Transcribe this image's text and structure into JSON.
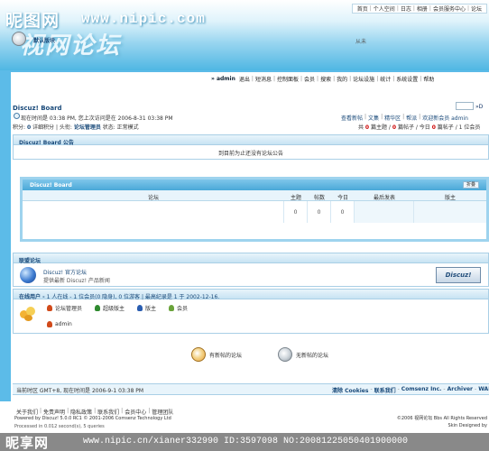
{
  "watermark": {
    "site_name": "昵图网",
    "site_url": "www.nipic.com",
    "bottom_logo": "昵享网",
    "bottom_text": "www.nipic.cn/xianer332990 ID:3597098 NO:20081225050401900000"
  },
  "header": {
    "brand_art": "视网论坛"
  },
  "topnav": [
    "首页",
    "个人空间",
    "日志",
    "相册",
    "会员服务中心",
    "论坛"
  ],
  "userbar": {
    "user": "» admin",
    "links": [
      "退出",
      "短消息",
      "控制面板",
      "会员",
      "搜索",
      "我的",
      "论坛设施",
      "统计",
      "系统设置",
      "帮助"
    ]
  },
  "search": {
    "go_label": "»D"
  },
  "breadcrumb": {
    "title": "Discuz! Board",
    "now_line": "现在时间是 03:38 PM, 您上次访问是在 2006-8-31 03:38 PM",
    "points_label": "积分: ",
    "points_value": "0",
    "points_rest": " 详细积分 | 头衔: ",
    "rank": "论坛管理员",
    "status": " 状态: 正常模式"
  },
  "quicklinks": [
    "查看新帖",
    "文集",
    "精华区",
    "帮派",
    "欢迎新会员 admin"
  ],
  "stats": {
    "prefix": "共 ",
    "topics": "0",
    "mid1": " 篇主题 / ",
    "posts": "0",
    "mid2": " 篇帖子 / 今日 ",
    "today": "0",
    "suffix": " 篇帖子 / 1 位会员"
  },
  "announcement": {
    "title": "Discuz! Board 公告",
    "body": "到目前为止还没有论坛公告"
  },
  "boards": {
    "category": "Discuz! Board",
    "collapse_label": "折叠",
    "columns": [
      "论坛",
      "主题",
      "帖数",
      "今日",
      "最后发表",
      "版主"
    ],
    "rows": [
      {
        "name": "默认版块",
        "topics": "0",
        "posts": "0",
        "today": "0",
        "last_post": "从未",
        "moderator": ""
      }
    ]
  },
  "links_section": {
    "title": "联盟论坛",
    "name": "Discuz! 官方论坛",
    "desc": "提供最新 Discuz! 产品新闻",
    "badge": "Discuz!"
  },
  "online": {
    "head_prefix": "在线用户 - ",
    "head_main": "1 人在线 - 1 位会员(0 隐身), 0 位游客 | 最高纪录是 1 于 2002-12-16.",
    "legend": [
      {
        "label": "论坛管理员",
        "color": "#d14a1a"
      },
      {
        "label": "超级版主",
        "color": "#2f8a2f"
      },
      {
        "label": "版主",
        "color": "#2a5db0"
      },
      {
        "label": "会员",
        "color": "#6aa33a"
      }
    ],
    "users": [
      "admin"
    ]
  },
  "legend_icons": [
    {
      "label": "有新帖的论坛",
      "color": "#e9a23b"
    },
    {
      "label": "无新帖的论坛",
      "color": "#8b949c"
    }
  ],
  "footer": {
    "time": "当前时区 GMT+8, 现在时间是 2006-9-1 03:38 PM",
    "links": [
      "清除 Cookies",
      "联系我们",
      "Comsenz Inc.",
      "Archiver",
      "WAP"
    ]
  },
  "footer2": {
    "links": [
      "关于我们",
      "免责声明",
      "隐私政策",
      "联系我们",
      "会员中心",
      "管理团队"
    ],
    "powered": "Powered by Discuz! 5.0.0 RC1 © 2001-2006 Comsenz Technology Ltd",
    "queries": "Processed in 0.012 second(s), 5 queries",
    "right1": "©2006 视网论坛 Bbs All Rights Reserved",
    "right2": "Skin Designed by"
  },
  "colors": {
    "accent": "#4aa8d8",
    "blue_bg": "#5cbbe8",
    "link": "#1a4a7a",
    "highlight": "#c00000"
  },
  "icons": [
    "clock-icon",
    "board-icon",
    "globe-icon",
    "people-icon",
    "user-icon",
    "new-posts-icon",
    "no-new-posts-icon"
  ]
}
